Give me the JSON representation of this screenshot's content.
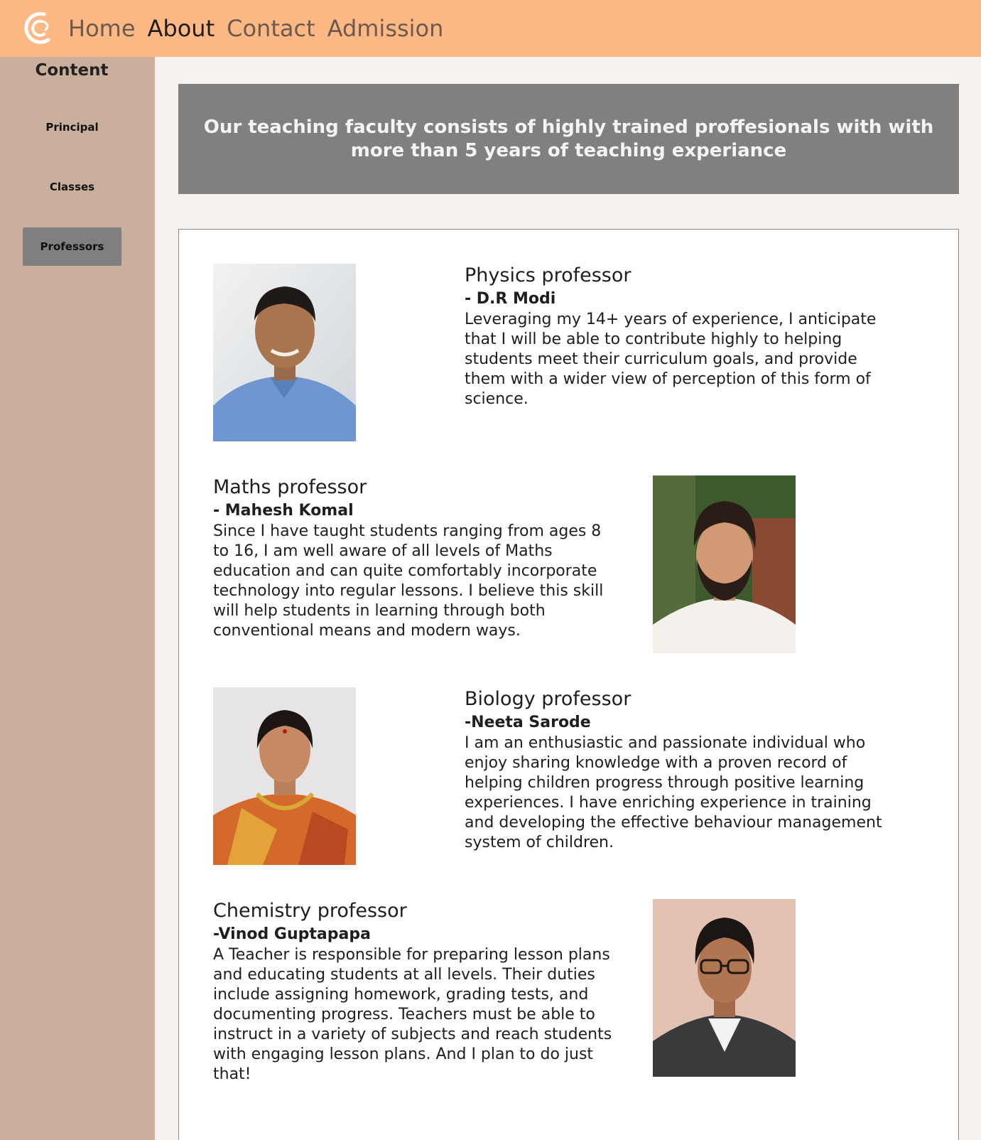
{
  "nav": {
    "logo_icon": "crescent-c-logo",
    "links": [
      "Home",
      "About",
      "Contact",
      "Admission"
    ],
    "active": "About"
  },
  "sidebar": {
    "title": "Content",
    "items": [
      {
        "label": "Principal",
        "active": false
      },
      {
        "label": "Classes",
        "active": false
      },
      {
        "label": "Professors",
        "active": true
      }
    ]
  },
  "banner": {
    "text": "Our teaching faculty consists of highly trained proffesionals with with more than 5 years of teaching experiance"
  },
  "professors": [
    {
      "title": "Physics professor",
      "name": "- D.R Modi",
      "bio": "Leveraging my 14+ years of experience, I anticipate that I will be able to contribute highly to helping students meet their curriculum goals, and provide them with a wider view of perception of this form of science.",
      "photo": "portrait-man-blue-shirt"
    },
    {
      "title": "Maths professor",
      "name": "- Mahesh Komal",
      "bio": "Since I have taught students ranging from ages 8 to 16, I am well aware of all levels of Maths education and can quite comfortably incorporate technology into regular lessons. I believe this skill will help students in learning through both conventional means and modern ways.",
      "photo": "portrait-bearded-man-white-kurta"
    },
    {
      "title": "Biology professor",
      "name": "-Neeta Sarode",
      "bio": "I am an enthusiastic and passionate individual who enjoy sharing knowledge with a proven record of helping children progress through positive learning experiences. I have enriching experience in training and developing the effective behaviour management system of children.",
      "photo": "portrait-woman-saree"
    },
    {
      "title": "Chemistry professor",
      "name": "-Vinod Guptapapa",
      "bio": "A Teacher is responsible for preparing lesson plans and educating students at all levels. Their duties include assigning homework, grading tests, and documenting progress. Teachers must be able to instruct in a variety of subjects and reach students with engaging lesson plans. And I plan to do just that!",
      "photo": "portrait-man-glasses-suit"
    }
  ],
  "colors": {
    "navbar": "#fdb883",
    "sidebar": "#c9af9c",
    "banner": "#808080",
    "page_bg": "#f5f2ef"
  }
}
